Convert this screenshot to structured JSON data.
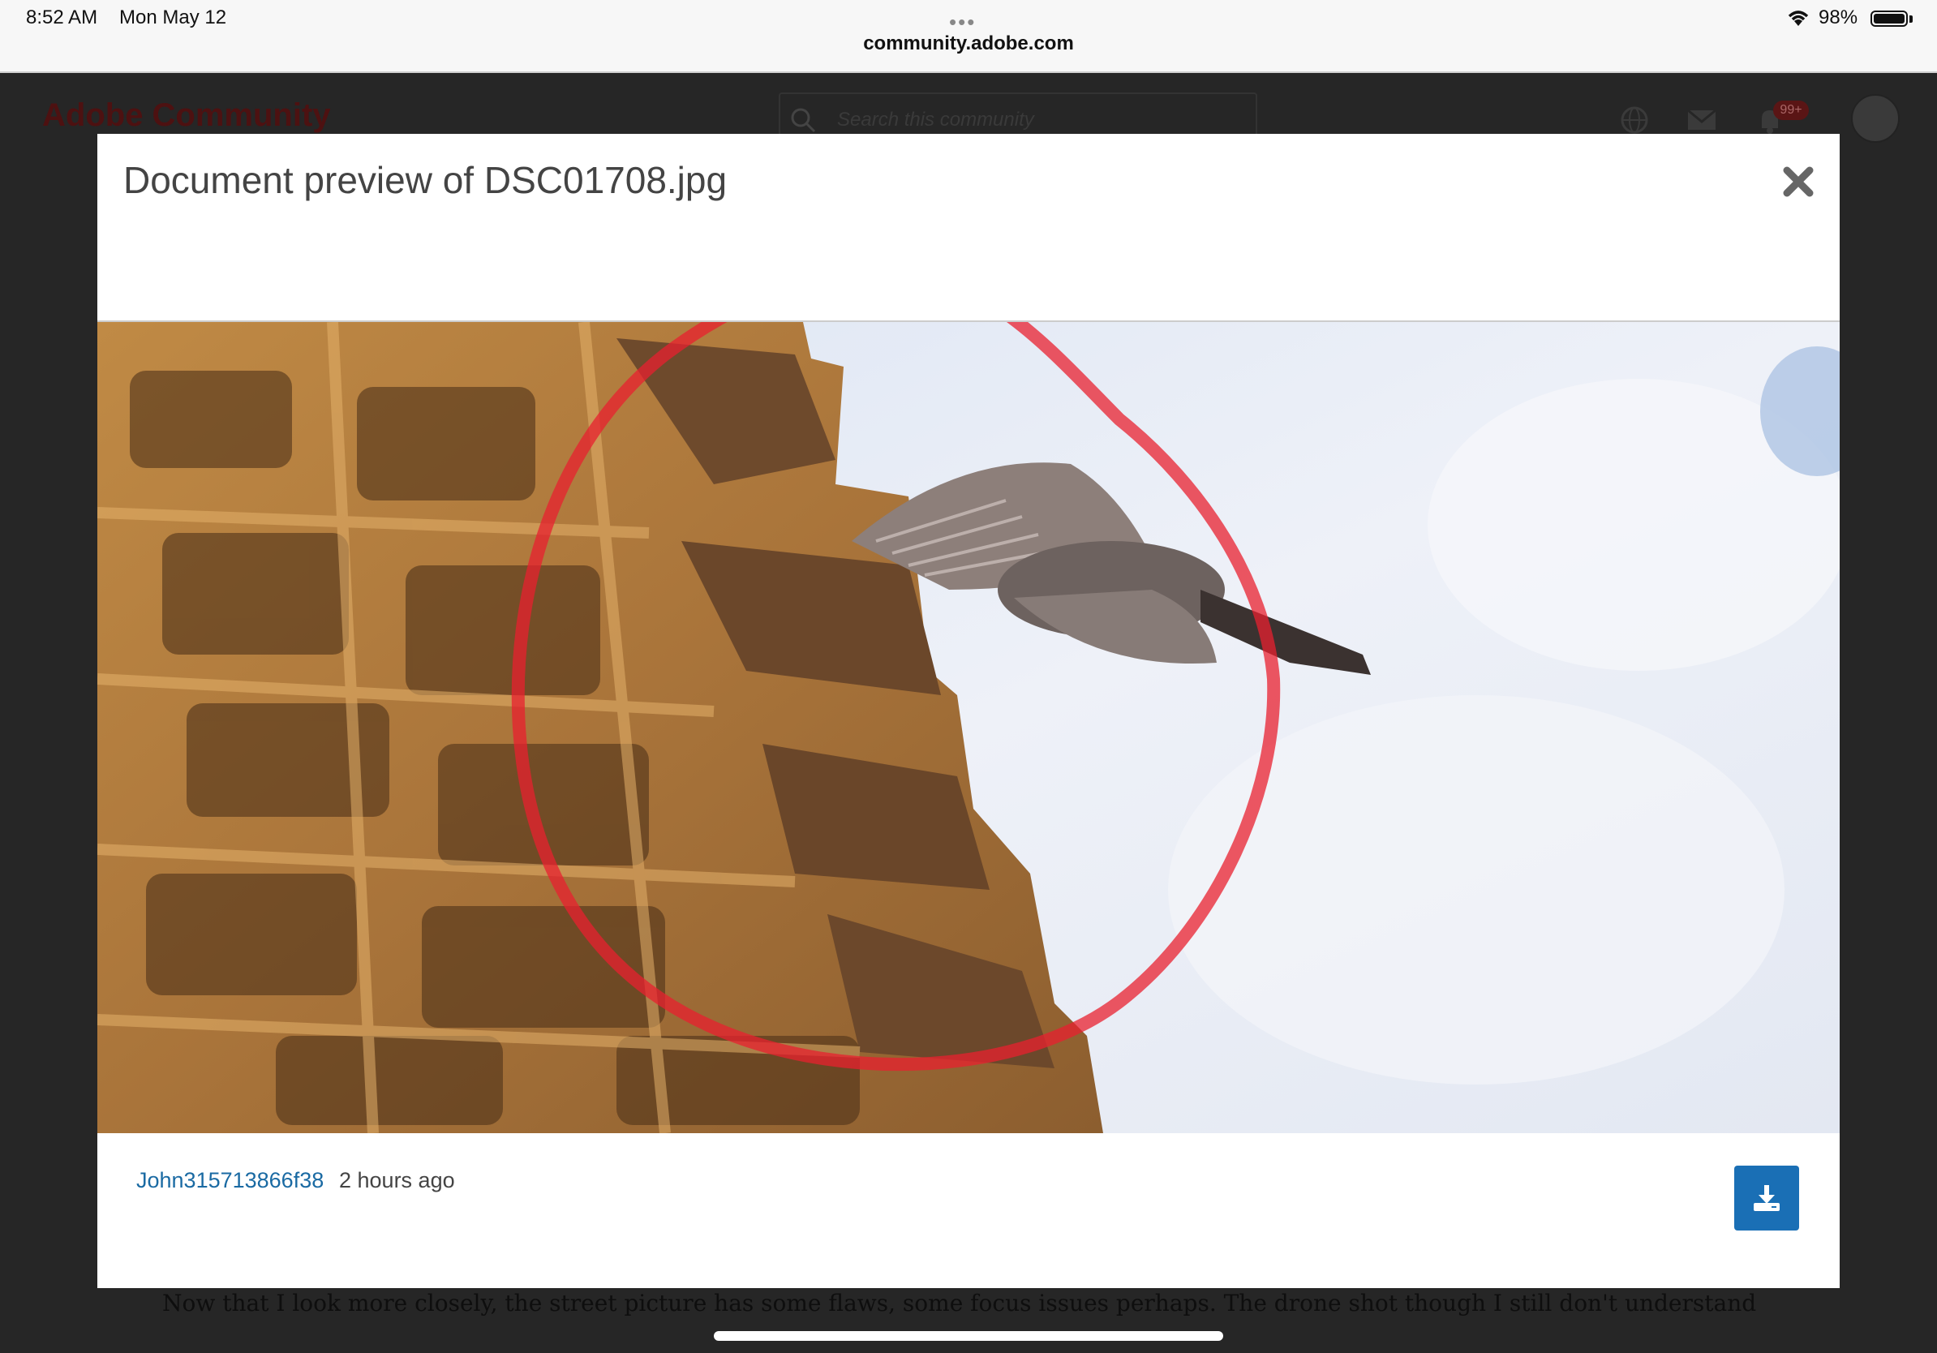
{
  "status_bar": {
    "time": "8:52 AM",
    "date": "Mon May 12",
    "url": "community.adobe.com",
    "battery": "98%"
  },
  "site": {
    "logo": "Adobe Community",
    "search_placeholder": "Search this community",
    "notification_count": "99+",
    "body_text": "Now that I look more closely, the street picture has some flaws, some focus issues perhaps. The drone shot though I still don't understand"
  },
  "modal": {
    "title": "Document preview of DSC01708.jpg",
    "author": "John315713866f38",
    "time_ago": "2 hours ago"
  },
  "icons": {
    "close": "close-icon",
    "download": "download-icon",
    "globe": "globe-icon",
    "mail": "mail-icon",
    "bell": "bell-icon",
    "search": "search-icon"
  },
  "colors": {
    "link": "#1a6aa3",
    "download_button": "#1a6fb5",
    "annotation_circle": "#e8202f"
  }
}
